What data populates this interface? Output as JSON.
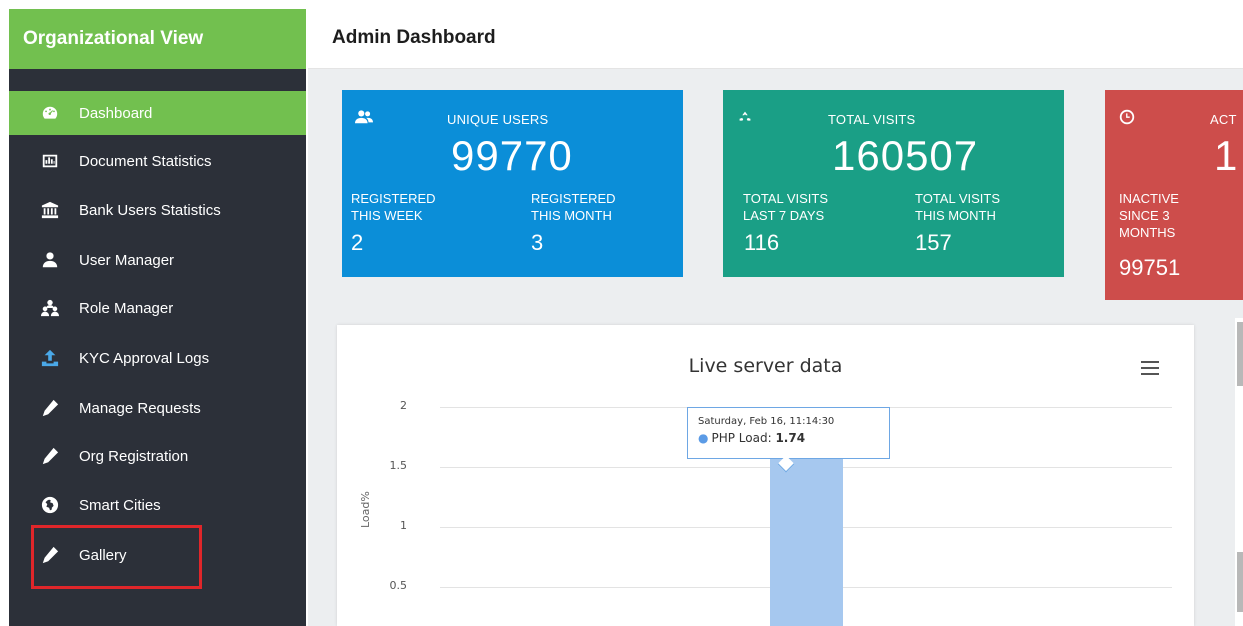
{
  "sidebar": {
    "brand": "Organizational View",
    "items": [
      {
        "label": "Dashboard",
        "icon": "dashboard-icon",
        "active": true
      },
      {
        "label": "Document Statistics",
        "icon": "bar-chart-icon"
      },
      {
        "label": "Bank Users Statistics",
        "icon": "bank-icon"
      },
      {
        "label": "User Manager",
        "icon": "user-icon"
      },
      {
        "label": "Role Manager",
        "icon": "sitemap-icon"
      },
      {
        "label": "KYC Approval Logs",
        "icon": "upload-icon"
      },
      {
        "label": "Manage Requests",
        "icon": "pencil-icon"
      },
      {
        "label": "Org Registration",
        "icon": "pencil-icon"
      },
      {
        "label": "Smart Cities",
        "icon": "globe-icon"
      },
      {
        "label": "Gallery",
        "icon": "pencil-icon"
      }
    ]
  },
  "header": {
    "title": "Admin Dashboard"
  },
  "cards": {
    "users": {
      "icon": "users-icon",
      "title": "UNIQUE USERS",
      "value": "99770",
      "sub1_label_line1": "REGISTERED",
      "sub1_label_line2": "THIS WEEK",
      "sub1_value": "2",
      "sub2_label_line1": "REGISTERED",
      "sub2_label_line2": "THIS MONTH",
      "sub2_value": "3"
    },
    "visits": {
      "icon": "recycle-icon",
      "title": "TOTAL VISITS",
      "value": "160507",
      "sub1_label_line1": "TOTAL VISITS",
      "sub1_label_line2": "LAST 7 DAYS",
      "sub1_value": "116",
      "sub2_label_line1": "TOTAL VISITS",
      "sub2_label_line2": "THIS MONTH",
      "sub2_value": "157"
    },
    "active": {
      "icon": "clock-icon",
      "title": "ACT",
      "value": "1",
      "sub1_label_line1": "INACTIVE",
      "sub1_label_line2": "SINCE 3",
      "sub1_label_line3": "MONTHS",
      "sub1_value": "99751"
    }
  },
  "chart": {
    "title": "Live server data",
    "tooltip_date": "Saturday, Feb 16, 11:14:30",
    "tooltip_series": "PHP Load",
    "tooltip_value": "1.74"
  },
  "chart_data": {
    "type": "bar",
    "title": "Live server data",
    "ylabel": "Load%",
    "yticks": [
      "2",
      "1.5",
      "1",
      "0.5"
    ],
    "ylim": [
      0,
      2
    ],
    "series": [
      {
        "name": "PHP Load",
        "values": [
          1.74
        ]
      }
    ],
    "categories": [
      "Saturday, Feb 16, 11:14:30"
    ],
    "color": "#a6c8ef",
    "grid": true
  }
}
